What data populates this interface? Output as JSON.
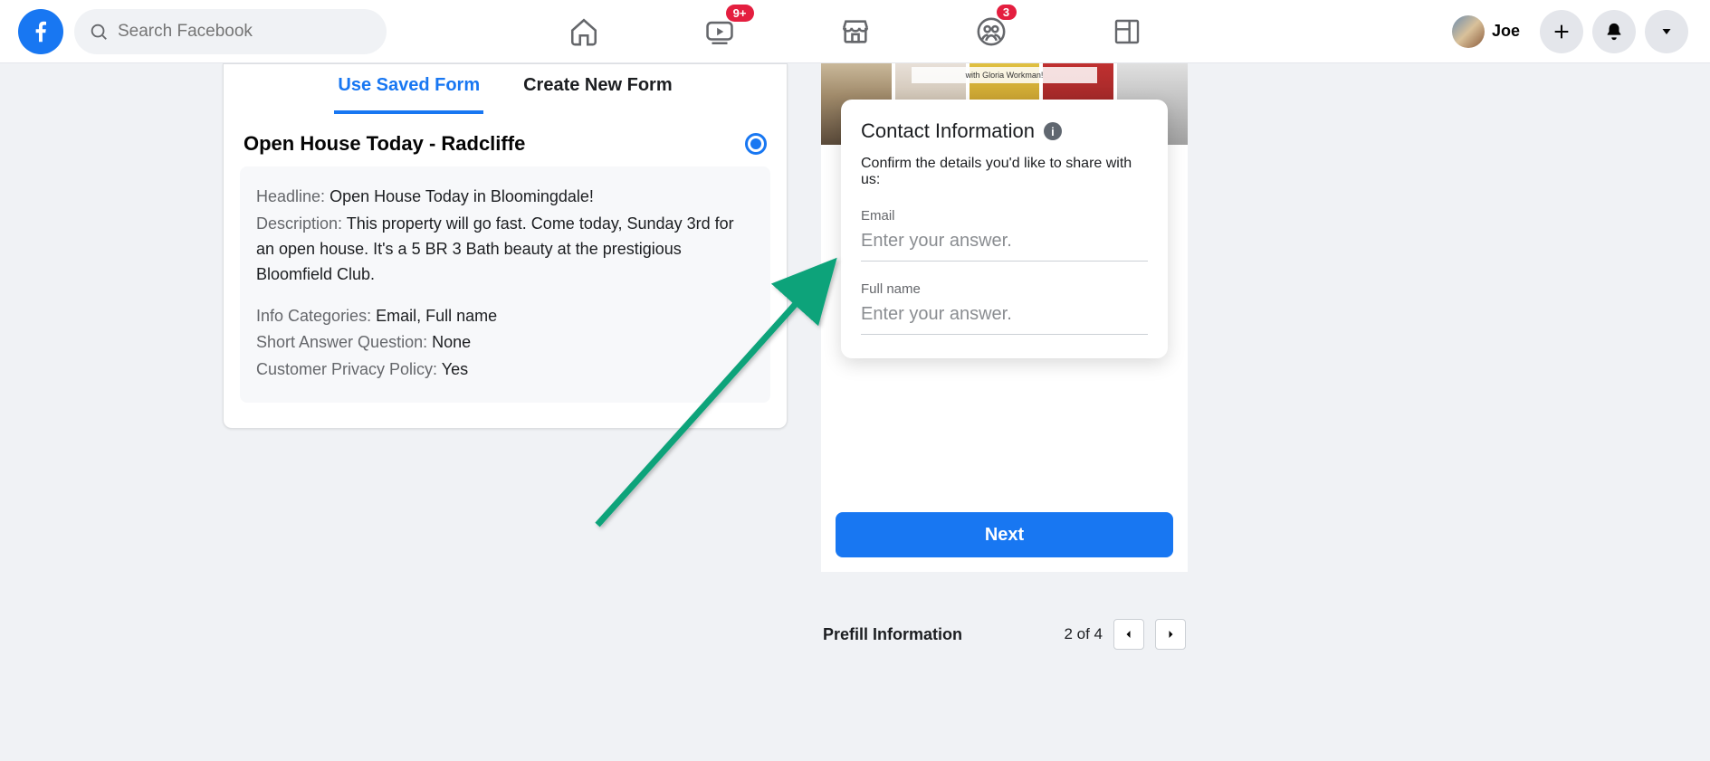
{
  "header": {
    "search_placeholder": "Search Facebook",
    "badges": {
      "watch": "9+",
      "groups": "3"
    },
    "profile_name": "Joe"
  },
  "form_panel": {
    "tabs": {
      "saved": "Use Saved Form",
      "create": "Create New Form"
    },
    "form_name": "Open House Today - Radcliffe",
    "headline_label": "Headline:",
    "headline_value": "Open House Today in Bloomingdale!",
    "description_label": "Description:",
    "description_value": "This property will go fast. Come today, Sunday 3rd for an open house. It's a 5 BR 3 Bath beauty at the prestigious Bloomfield Club.",
    "info_cats_label": "Info Categories:",
    "info_cats_value": "Email, Full name",
    "saq_label": "Short Answer Question:",
    "saq_value": "None",
    "privacy_label": "Customer Privacy Policy:",
    "privacy_value": "Yes"
  },
  "preview": {
    "bg_caption": "with Gloria Workman!",
    "card_title": "Contact Information",
    "card_subtitle": "Confirm the details you'd like to share with us:",
    "fields": {
      "email_label": "Email",
      "email_placeholder": "Enter your answer.",
      "fullname_label": "Full name",
      "fullname_placeholder": "Enter your answer."
    },
    "next_button": "Next"
  },
  "prefill": {
    "label": "Prefill Information",
    "pager_text": "2 of 4"
  }
}
